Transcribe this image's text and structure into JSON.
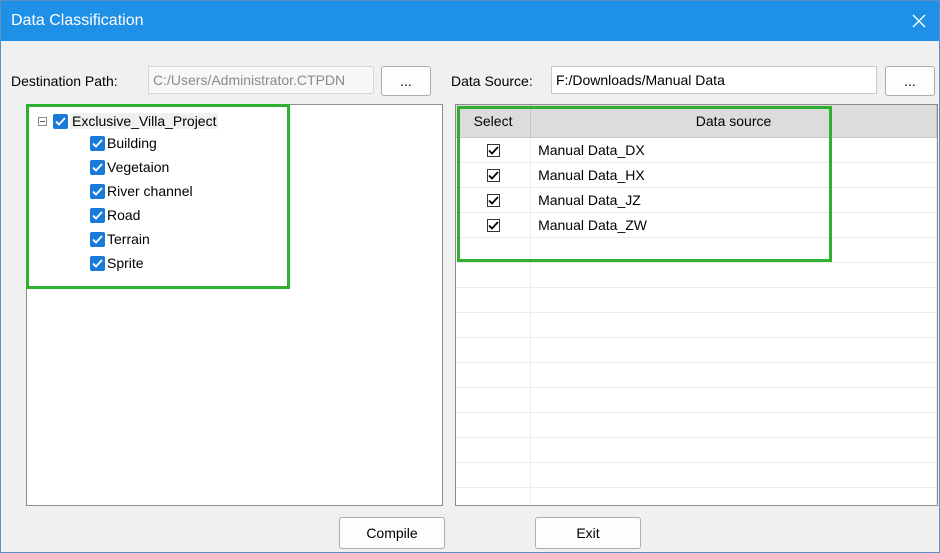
{
  "window": {
    "title": "Data Classification"
  },
  "destination": {
    "label": "Destination Path:",
    "value": "C:/Users/Administrator.CTPDN",
    "browse_label": "..."
  },
  "source": {
    "label": "Data Source:",
    "value": "F:/Downloads/Manual Data",
    "browse_label": "..."
  },
  "tree": {
    "root": "Exclusive_Villa_Project",
    "children": [
      "Building",
      "Vegetaion",
      "River channel",
      "Road",
      "Terrain",
      "Sprite"
    ]
  },
  "table": {
    "headers": [
      "Select",
      "Data source"
    ],
    "rows": [
      {
        "checked": true,
        "name": "Manual Data_DX"
      },
      {
        "checked": true,
        "name": "Manual Data_HX"
      },
      {
        "checked": true,
        "name": "Manual Data_JZ"
      },
      {
        "checked": true,
        "name": "Manual Data_ZW"
      }
    ]
  },
  "buttons": {
    "compile": "Compile",
    "exit": "Exit"
  },
  "colors": {
    "titlebar": "#1e90e6",
    "highlight": "#2fb02f",
    "checkbox": "#1a7ad8"
  }
}
